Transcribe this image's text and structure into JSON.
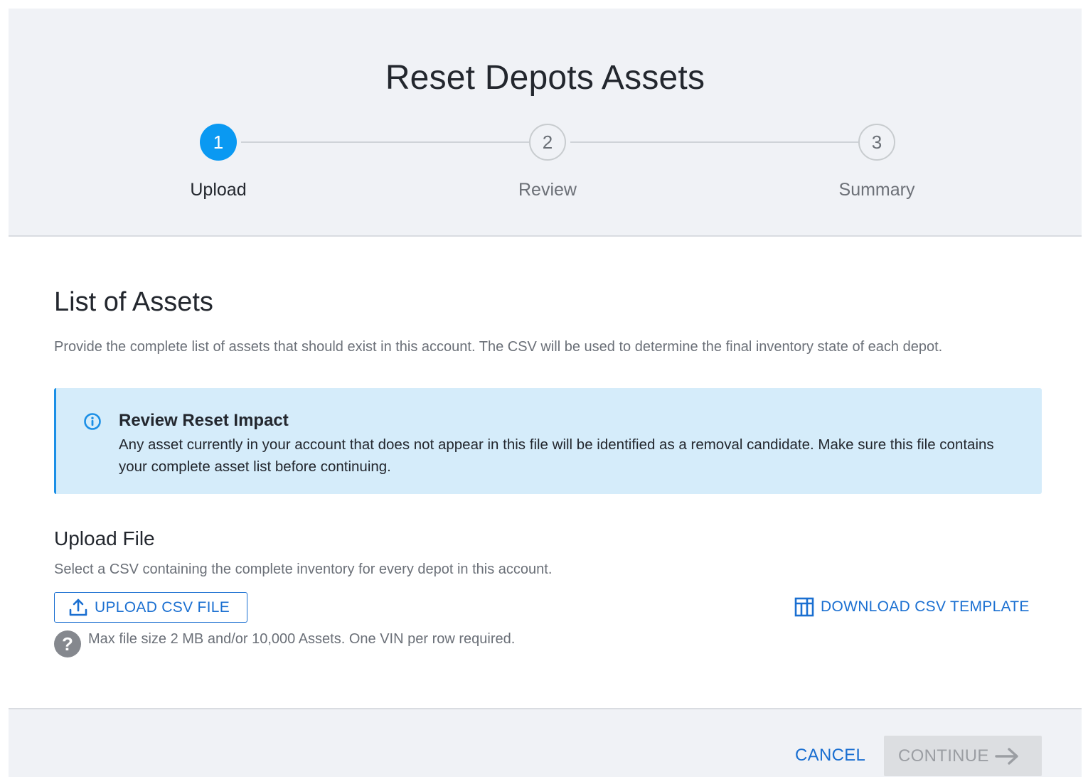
{
  "header": {
    "title": "Reset Depots Assets"
  },
  "stepper": {
    "steps": [
      {
        "number": "1",
        "label": "Upload",
        "state": "active"
      },
      {
        "number": "2",
        "label": "Review",
        "state": "inactive"
      },
      {
        "number": "3",
        "label": "Summary",
        "state": "inactive"
      }
    ]
  },
  "assets_section": {
    "title": "List of Assets",
    "description": "Provide the complete list of assets that should exist in this account. The CSV will be used to determine the final inventory state of each depot."
  },
  "alert": {
    "icon": "info-icon",
    "title": "Review Reset Impact",
    "body": "Any asset currently in your account that does not appear in this file will be identified as a removal candidate. Make sure this file contains your complete asset list before continuing."
  },
  "upload": {
    "title": "Upload File",
    "description": "Select a CSV containing the complete inventory for every depot in this account.",
    "upload_button_label": "UPLOAD CSV FILE",
    "upload_icon": "upload-icon",
    "download_link_label": "DOWNLOAD CSV TEMPLATE",
    "download_icon": "table-icon",
    "help_icon": "help-icon",
    "help_text": "Max file size 2 MB and/or 10,000 Assets. One VIN per row required."
  },
  "footer": {
    "cancel_label": "CANCEL",
    "continue_label": "CONTINUE",
    "continue_disabled": true
  },
  "colors": {
    "accent": "#1a6fd1",
    "step_active": "#0a99f2",
    "alert_bg": "#d5ecfa",
    "header_bg": "#f0f2f6"
  }
}
